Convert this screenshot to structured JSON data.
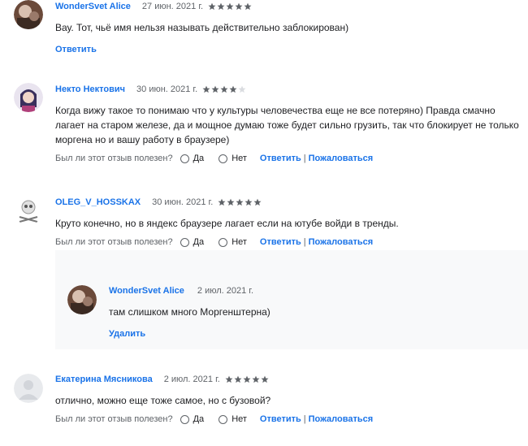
{
  "helpful_question": "Был ли этот отзыв полезен?",
  "yes_label": "Да",
  "no_label": "Нет",
  "reply_label": "Ответить",
  "report_label": "Пожаловаться",
  "delete_label": "Удалить",
  "separator": "|",
  "colors": {
    "accent": "#1a73e8",
    "star": "#5f6368",
    "star_empty": "#dadce0",
    "reply_bg": "#f8f9fa"
  },
  "reviews": [
    {
      "author": "WonderSvet Alice",
      "date": "27 июн. 2021 г.",
      "rating": 5,
      "text": "Вау. Тот, чьё имя нельзя называть действительно заблокирован)"
    },
    {
      "author": "Некто Нектович",
      "date": "30 июн. 2021 г.",
      "rating": 4,
      "text_lines": [
        "Когда вижу такое то понимаю что у культуры человечества еще не все потеряно) Правда смачно",
        "лагает на старом железе, да и мощное думаю тоже будет сильно грузить, так что блокирует не только",
        "моргена но и вашу работу в браузере)"
      ]
    },
    {
      "author": "OLEG_V_HOSSKAX",
      "date": "30 июн. 2021 г.",
      "rating": 5,
      "text": "Круто конечно, но в яндекс браузере лагает если на ютубе войди в тренды."
    },
    {
      "author": "Екатерина Мясникова",
      "date": "2 июл. 2021 г.",
      "rating": 5,
      "text": "отлично, можно еще тоже самое, но с бузовой?"
    }
  ],
  "reply": {
    "author": "WonderSvet Alice",
    "date": "2 июл. 2021 г.",
    "text": "там слишком много Моргенштерна)"
  }
}
